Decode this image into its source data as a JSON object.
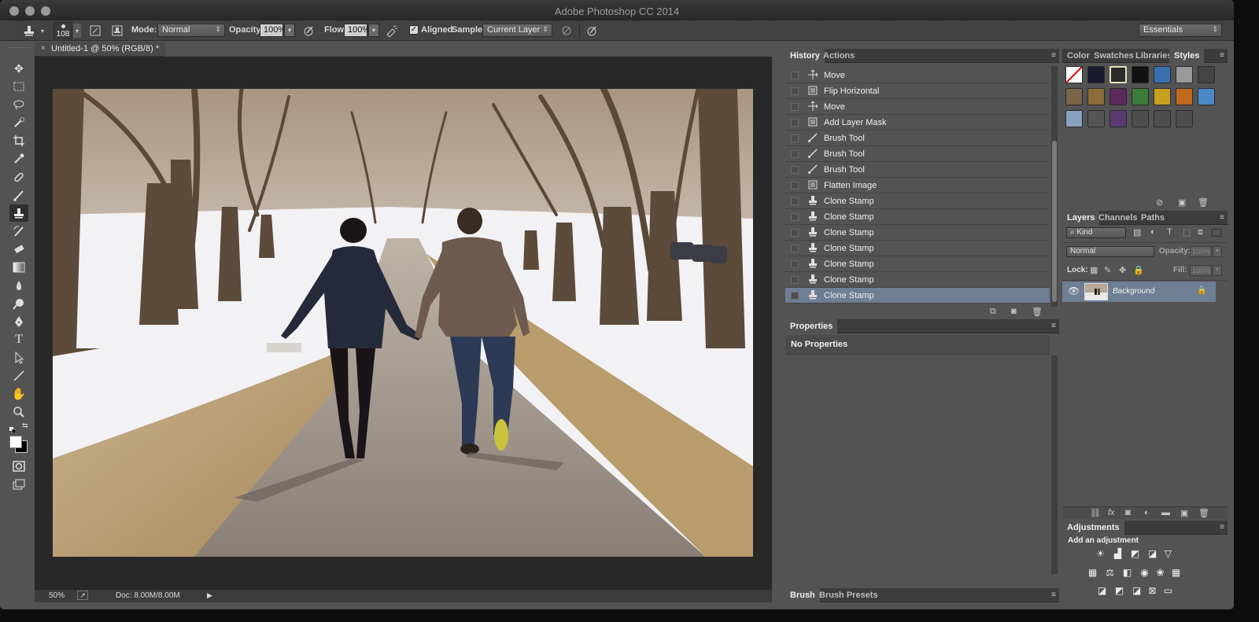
{
  "app": {
    "title": "Adobe Photoshop CC 2014"
  },
  "options_bar": {
    "tool_icon": "clone-stamp-icon",
    "brush_size": "108",
    "mode_label": "Mode:",
    "mode_value": "Normal",
    "opacity_label": "Opacity:",
    "opacity_value": "100%",
    "flow_label": "Flow:",
    "flow_value": "100%",
    "aligned_label": "Aligned",
    "aligned_checked": true,
    "sample_label": "Sample:",
    "sample_value": "Current Layer",
    "workspace": "Essentials"
  },
  "document": {
    "tab_title": "Untitled-1 @ 50% (RGB/8) *",
    "zoom": "50%",
    "doc_info": "Doc: 8.00M/8.00M"
  },
  "history_panel": {
    "tabs": [
      "History",
      "Actions"
    ],
    "items": [
      {
        "label": "Move",
        "icon": "move-icon"
      },
      {
        "label": "Flip Horizontal",
        "icon": "document-icon"
      },
      {
        "label": "Move",
        "icon": "move-icon"
      },
      {
        "label": "Add Layer Mask",
        "icon": "document-icon"
      },
      {
        "label": "Brush Tool",
        "icon": "brush-icon"
      },
      {
        "label": "Brush Tool",
        "icon": "brush-icon"
      },
      {
        "label": "Brush Tool",
        "icon": "brush-icon"
      },
      {
        "label": "Flatten Image",
        "icon": "document-icon"
      },
      {
        "label": "Clone Stamp",
        "icon": "clone-stamp-icon"
      },
      {
        "label": "Clone Stamp",
        "icon": "clone-stamp-icon"
      },
      {
        "label": "Clone Stamp",
        "icon": "clone-stamp-icon"
      },
      {
        "label": "Clone Stamp",
        "icon": "clone-stamp-icon"
      },
      {
        "label": "Clone Stamp",
        "icon": "clone-stamp-icon"
      },
      {
        "label": "Clone Stamp",
        "icon": "clone-stamp-icon"
      },
      {
        "label": "Clone Stamp",
        "icon": "clone-stamp-icon"
      }
    ],
    "selected_index": 14
  },
  "properties_panel": {
    "tab": "Properties",
    "content": "No Properties"
  },
  "brush_panel": {
    "tabs": [
      "Brush",
      "Brush Presets"
    ]
  },
  "styles_panel": {
    "tabs": [
      "Color",
      "Swatches",
      "Libraries",
      "Styles"
    ]
  },
  "layers_panel": {
    "tabs": [
      "Layers",
      "Channels",
      "Paths"
    ],
    "filter": "Kind",
    "blend_mode": "Normal",
    "opacity_label": "Opacity:",
    "opacity_value": "100%",
    "lock_label": "Lock:",
    "fill_label": "Fill:",
    "fill_value": "100%",
    "layers": [
      {
        "name": "Background",
        "visible": true,
        "locked": true
      }
    ]
  },
  "adjustments_panel": {
    "tab": "Adjustments",
    "heading": "Add an adjustment"
  },
  "colors": {
    "selection": "#6e7e93",
    "panel": "#535353",
    "canvas": "#282828"
  }
}
